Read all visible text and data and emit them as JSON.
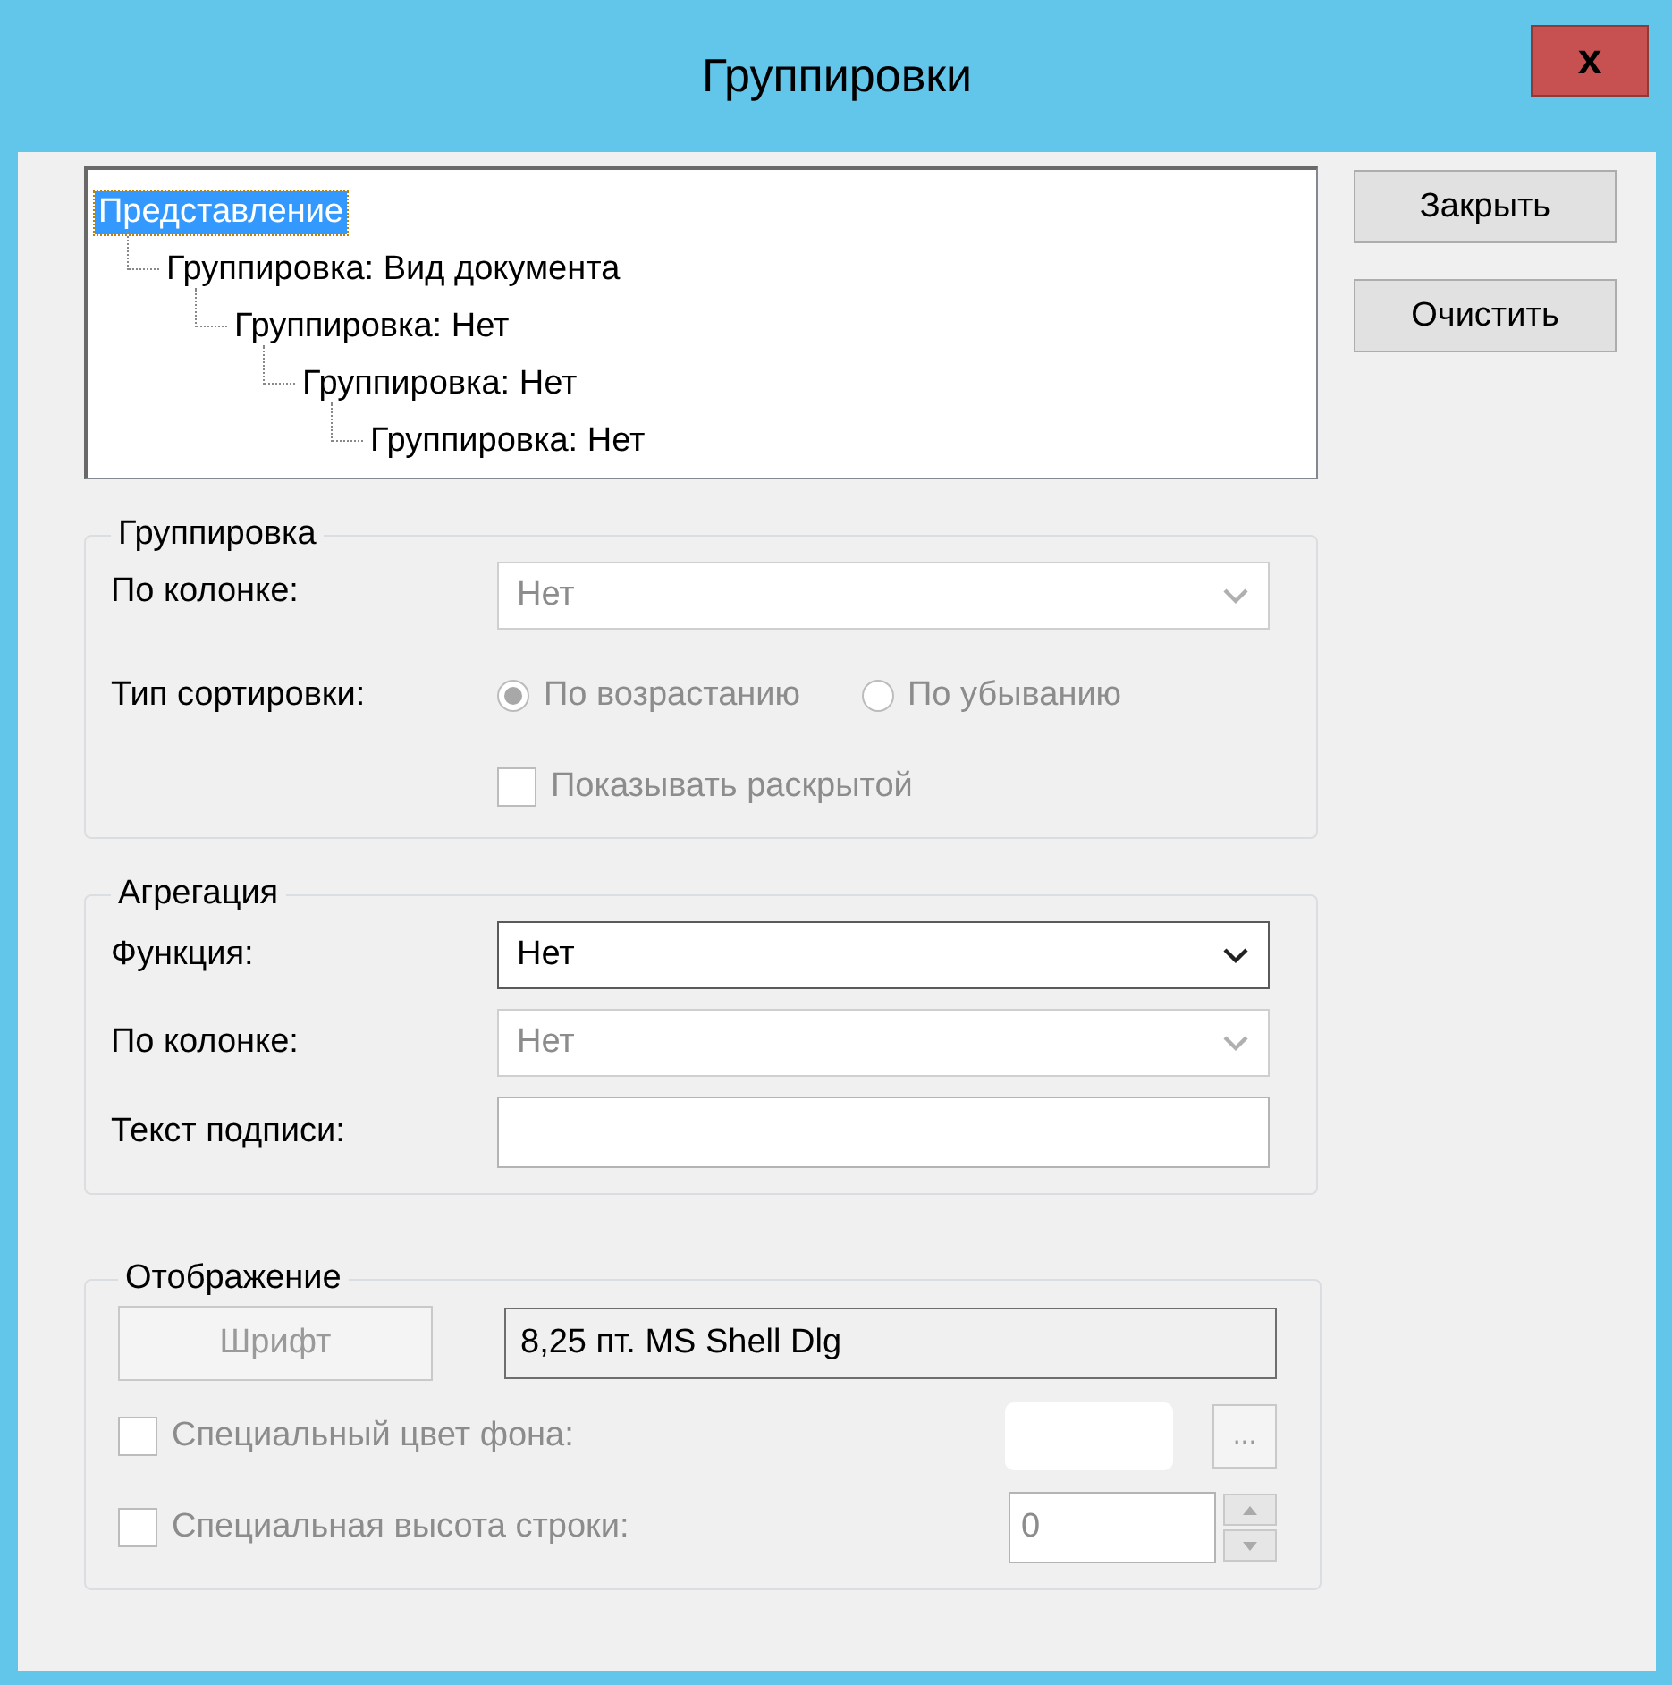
{
  "window": {
    "title": "Группировки",
    "close_label": "x"
  },
  "tree": {
    "label": "Представление",
    "selected": true,
    "children": [
      {
        "label": "Группировка: Вид документа",
        "selected": false,
        "children": [
          {
            "label": "Группировка: Нет",
            "selected": false,
            "children": [
              {
                "label": "Группировка: Нет",
                "selected": false,
                "children": [
                  {
                    "label": "Группировка: Нет",
                    "selected": false
                  }
                ]
              }
            ]
          }
        ]
      }
    ]
  },
  "buttons": [
    {
      "label": "Закрыть"
    },
    {
      "label": "Очистить"
    }
  ],
  "grouping": {
    "title": "Группировка",
    "column": {
      "label": "По колонке:",
      "value": "Нет",
      "disabled": true
    },
    "sort_label": "Тип сортировки:",
    "sort_options": [
      {
        "label": "По возрастанию",
        "selected": true,
        "disabled": true
      },
      {
        "label": "По убыванию",
        "selected": false,
        "disabled": true
      }
    ],
    "expanded": {
      "label": "Показывать раскрытой",
      "checked": false,
      "disabled": true
    }
  },
  "aggregation": {
    "title": "Агрегация",
    "function": {
      "label": "Функция:",
      "value": "Нет",
      "disabled": false
    },
    "column": {
      "label": "По колонке:",
      "value": "Нет",
      "disabled": true
    },
    "caption": {
      "label": "Текст подписи:"
    }
  },
  "display": {
    "title": "Отображение",
    "font_button": {
      "label": "Шрифт",
      "disabled": true
    },
    "font_value": "8,25 пт. MS Shell Dlg",
    "bg_color": {
      "label": "Специальный цвет фона:",
      "checked": false,
      "disabled": true,
      "button": "..."
    },
    "row_height": {
      "label": "Специальная высота строки:",
      "checked": false,
      "disabled": true,
      "value": "0"
    }
  }
}
